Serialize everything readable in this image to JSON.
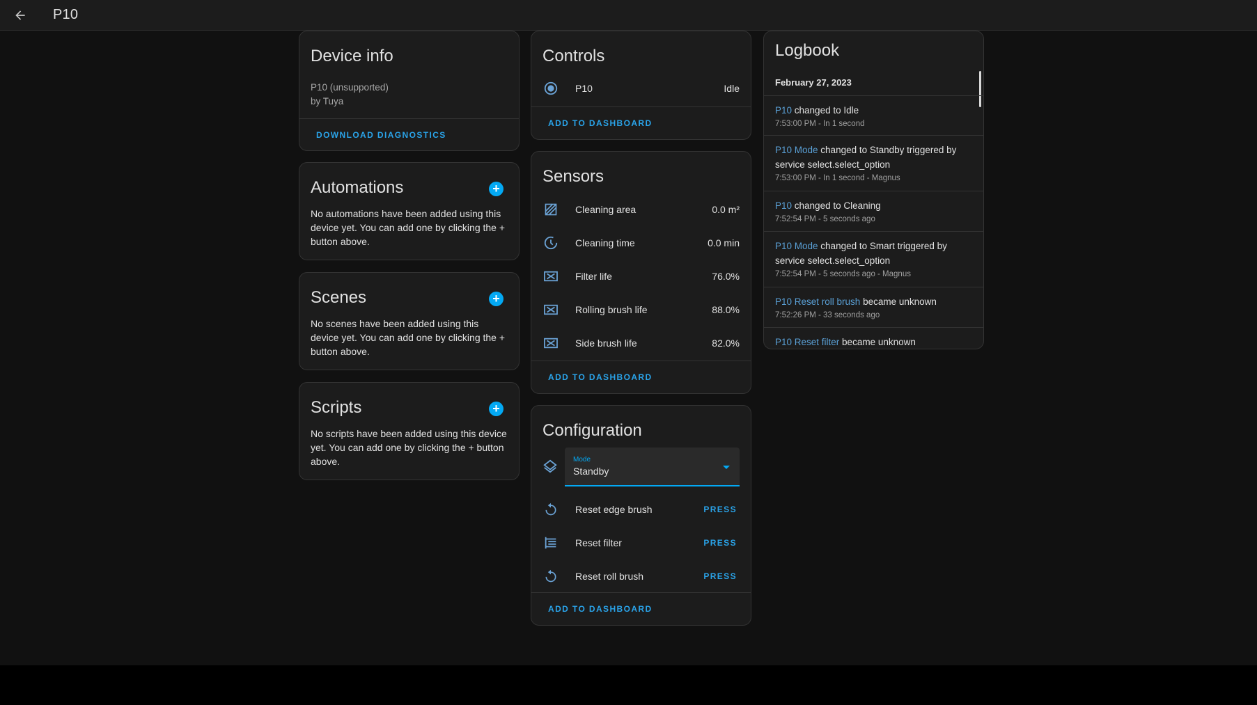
{
  "header": {
    "title": "P10",
    "back_icon": "arrow-left-icon"
  },
  "device_info": {
    "title": "Device info",
    "model": "P10 (unsupported)",
    "manufacturer": "by Tuya",
    "action": "DOWNLOAD DIAGNOSTICS"
  },
  "automations": {
    "title": "Automations",
    "text": "No automations have been added using this device yet. You can add one by clicking the + button above."
  },
  "scenes": {
    "title": "Scenes",
    "text": "No scenes have been added using this device yet. You can add one by clicking the + button above."
  },
  "scripts": {
    "title": "Scripts",
    "text": "No scripts have been added using this device yet. You can add one by clicking the + button above."
  },
  "add_symbol": "+",
  "controls": {
    "title": "Controls",
    "items": [
      {
        "icon": "robot-vacuum-icon",
        "label": "P10",
        "value": "Idle"
      }
    ],
    "action": "ADD TO DASHBOARD"
  },
  "sensors": {
    "title": "Sensors",
    "items": [
      {
        "icon": "square-hatch-icon",
        "label": "Cleaning area",
        "value": "0.0 m²"
      },
      {
        "icon": "clock-icon",
        "label": "Cleaning time",
        "value": "0.0 min"
      },
      {
        "icon": "filter-icon",
        "label": "Filter life",
        "value": "76.0%"
      },
      {
        "icon": "filter-icon",
        "label": "Rolling brush life",
        "value": "88.0%"
      },
      {
        "icon": "filter-icon",
        "label": "Side brush life",
        "value": "82.0%"
      }
    ],
    "action": "ADD TO DASHBOARD"
  },
  "configuration": {
    "title": "Configuration",
    "mode": {
      "icon": "layers-icon",
      "label": "Mode",
      "value": "Standby"
    },
    "buttons": [
      {
        "icon": "restart-icon",
        "label": "Reset edge brush",
        "action": "PRESS"
      },
      {
        "icon": "filter-list-icon",
        "label": "Reset filter",
        "action": "PRESS"
      },
      {
        "icon": "restart-icon",
        "label": "Reset roll brush",
        "action": "PRESS"
      }
    ],
    "action": "ADD TO DASHBOARD"
  },
  "logbook": {
    "title": "Logbook",
    "date": "February 27, 2023",
    "entries": [
      {
        "entity": "P10",
        "message": " changed to Idle",
        "meta": "7:53:00 PM - In 1 second"
      },
      {
        "entity": "P10 Mode",
        "message": " changed to Standby triggered by service select.select_option",
        "meta": "7:53:00 PM - In 1 second - Magnus"
      },
      {
        "entity": "P10",
        "message": " changed to Cleaning",
        "meta": "7:52:54 PM - 5 seconds ago"
      },
      {
        "entity": "P10 Mode",
        "message": " changed to Smart triggered by service select.select_option",
        "meta": "7:52:54 PM - 5 seconds ago - Magnus"
      },
      {
        "entity": "P10 Reset roll brush",
        "message": " became unknown",
        "meta": "7:52:26 PM - 33 seconds ago"
      },
      {
        "entity": "P10 Reset filter",
        "message": " became unknown",
        "meta": ""
      }
    ]
  },
  "colors": {
    "accent": "#03a9f4",
    "link": "#5aa0d6",
    "card": "#1c1c1c",
    "background": "#111111"
  }
}
